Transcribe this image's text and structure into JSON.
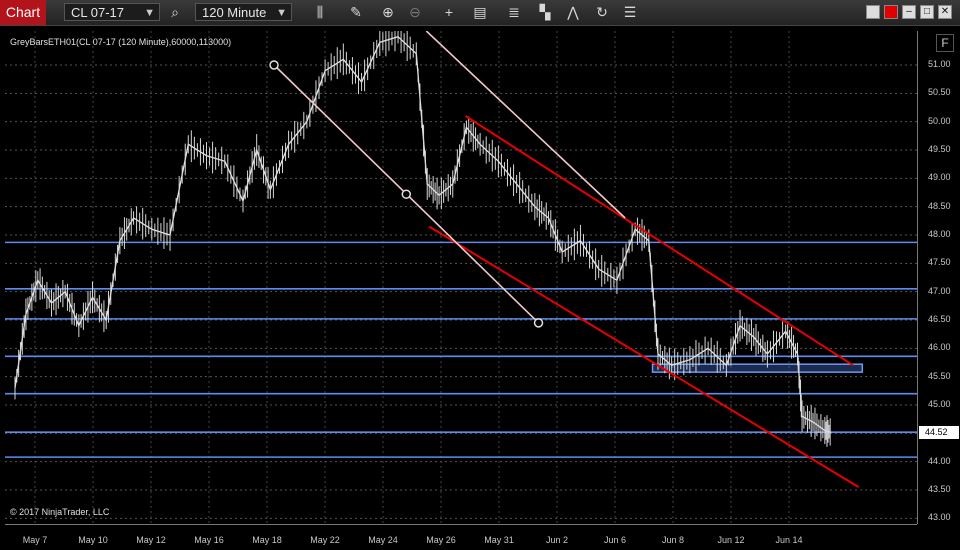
{
  "toolbar": {
    "chart_tab": "Chart",
    "instrument": "CL 07-17",
    "interval": "120 Minute",
    "icons": [
      "search-icon",
      "bars-icon",
      "pencil-icon",
      "zoom-in-icon",
      "zoom-out-icon",
      "crosshair-icon",
      "data-box-icon",
      "strategy-icon",
      "indicators-icon",
      "drawing-tools-icon",
      "refresh-icon",
      "properties-icon"
    ],
    "window_buttons": [
      "minimize",
      "maximize",
      "restore",
      "close"
    ],
    "link_color": "#e00000"
  },
  "chart_header": {
    "series_label": "GreyBarsETH01(CL 07-17 (120 Minute),60000,113000)",
    "copyright": "© 2017 NinjaTrader, LLC",
    "f_button": "F"
  },
  "price_axis": {
    "ticks": [
      "51.00",
      "50.50",
      "50.00",
      "49.50",
      "49.00",
      "48.50",
      "48.00",
      "47.50",
      "47.00",
      "46.50",
      "46.00",
      "45.50",
      "45.00",
      "44.50",
      "44.00",
      "43.50",
      "43.00"
    ],
    "last_price": "44.52"
  },
  "chart_data": {
    "type": "line",
    "ylim": [
      42.9,
      51.6
    ],
    "x_ticks": [
      "May 7",
      "May 10",
      "May 12",
      "May 16",
      "May 18",
      "May 22",
      "May 24",
      "May 26",
      "May 31",
      "Jun 2",
      "Jun 6",
      "Jun 8",
      "Jun 12",
      "Jun 14"
    ],
    "horizontal_levels": [
      47.87,
      47.05,
      46.52,
      45.86,
      45.2,
      44.52,
      44.08
    ],
    "close_path": [
      [
        0.0,
        45.3
      ],
      [
        0.012,
        46.6
      ],
      [
        0.025,
        47.2
      ],
      [
        0.04,
        46.8
      ],
      [
        0.055,
        47.0
      ],
      [
        0.07,
        46.4
      ],
      [
        0.085,
        46.9
      ],
      [
        0.1,
        46.5
      ],
      [
        0.115,
        47.9
      ],
      [
        0.13,
        48.3
      ],
      [
        0.15,
        48.1
      ],
      [
        0.17,
        48.0
      ],
      [
        0.19,
        49.6
      ],
      [
        0.21,
        49.4
      ],
      [
        0.23,
        49.3
      ],
      [
        0.25,
        48.6
      ],
      [
        0.265,
        49.5
      ],
      [
        0.28,
        48.8
      ],
      [
        0.3,
        49.6
      ],
      [
        0.32,
        50.0
      ],
      [
        0.34,
        50.9
      ],
      [
        0.36,
        51.1
      ],
      [
        0.38,
        50.7
      ],
      [
        0.4,
        51.4
      ],
      [
        0.42,
        51.5
      ],
      [
        0.44,
        51.2
      ],
      [
        0.452,
        48.9
      ],
      [
        0.465,
        48.7
      ],
      [
        0.48,
        48.9
      ],
      [
        0.495,
        49.9
      ],
      [
        0.51,
        49.6
      ],
      [
        0.53,
        49.3
      ],
      [
        0.55,
        48.9
      ],
      [
        0.57,
        48.5
      ],
      [
        0.585,
        48.3
      ],
      [
        0.6,
        47.7
      ],
      [
        0.62,
        47.9
      ],
      [
        0.64,
        47.4
      ],
      [
        0.66,
        47.2
      ],
      [
        0.68,
        48.1
      ],
      [
        0.695,
        47.9
      ],
      [
        0.705,
        45.9
      ],
      [
        0.72,
        45.7
      ],
      [
        0.74,
        45.8
      ],
      [
        0.76,
        46.0
      ],
      [
        0.78,
        45.7
      ],
      [
        0.795,
        46.4
      ],
      [
        0.81,
        46.2
      ],
      [
        0.825,
        45.9
      ],
      [
        0.845,
        46.3
      ],
      [
        0.858,
        45.9
      ],
      [
        0.863,
        44.8
      ],
      [
        0.875,
        44.7
      ],
      [
        0.888,
        44.55
      ],
      [
        0.895,
        44.52
      ]
    ],
    "range_bar": [
      45.58,
      45.72,
      0.71,
      0.94
    ],
    "channel_lines": [
      {
        "color": "#e60000",
        "x1": 0.505,
        "y1": 50.1,
        "x2": 0.93,
        "y2": 45.7
      },
      {
        "color": "#e60000",
        "x1": 0.465,
        "y1": 48.15,
        "x2": 0.936,
        "y2": 43.55
      },
      {
        "color": "#f0c8c8",
        "x1": 0.462,
        "y1": 51.6,
        "x2": 0.68,
        "y2": 48.3
      },
      {
        "color": "#f0c8c8",
        "x1": 0.295,
        "y1": 51.0,
        "x2": 0.585,
        "y2": 46.45
      }
    ],
    "handle_points": [
      [
        0.295,
        51.0
      ],
      [
        0.44,
        48.72
      ],
      [
        0.585,
        46.45
      ]
    ]
  }
}
